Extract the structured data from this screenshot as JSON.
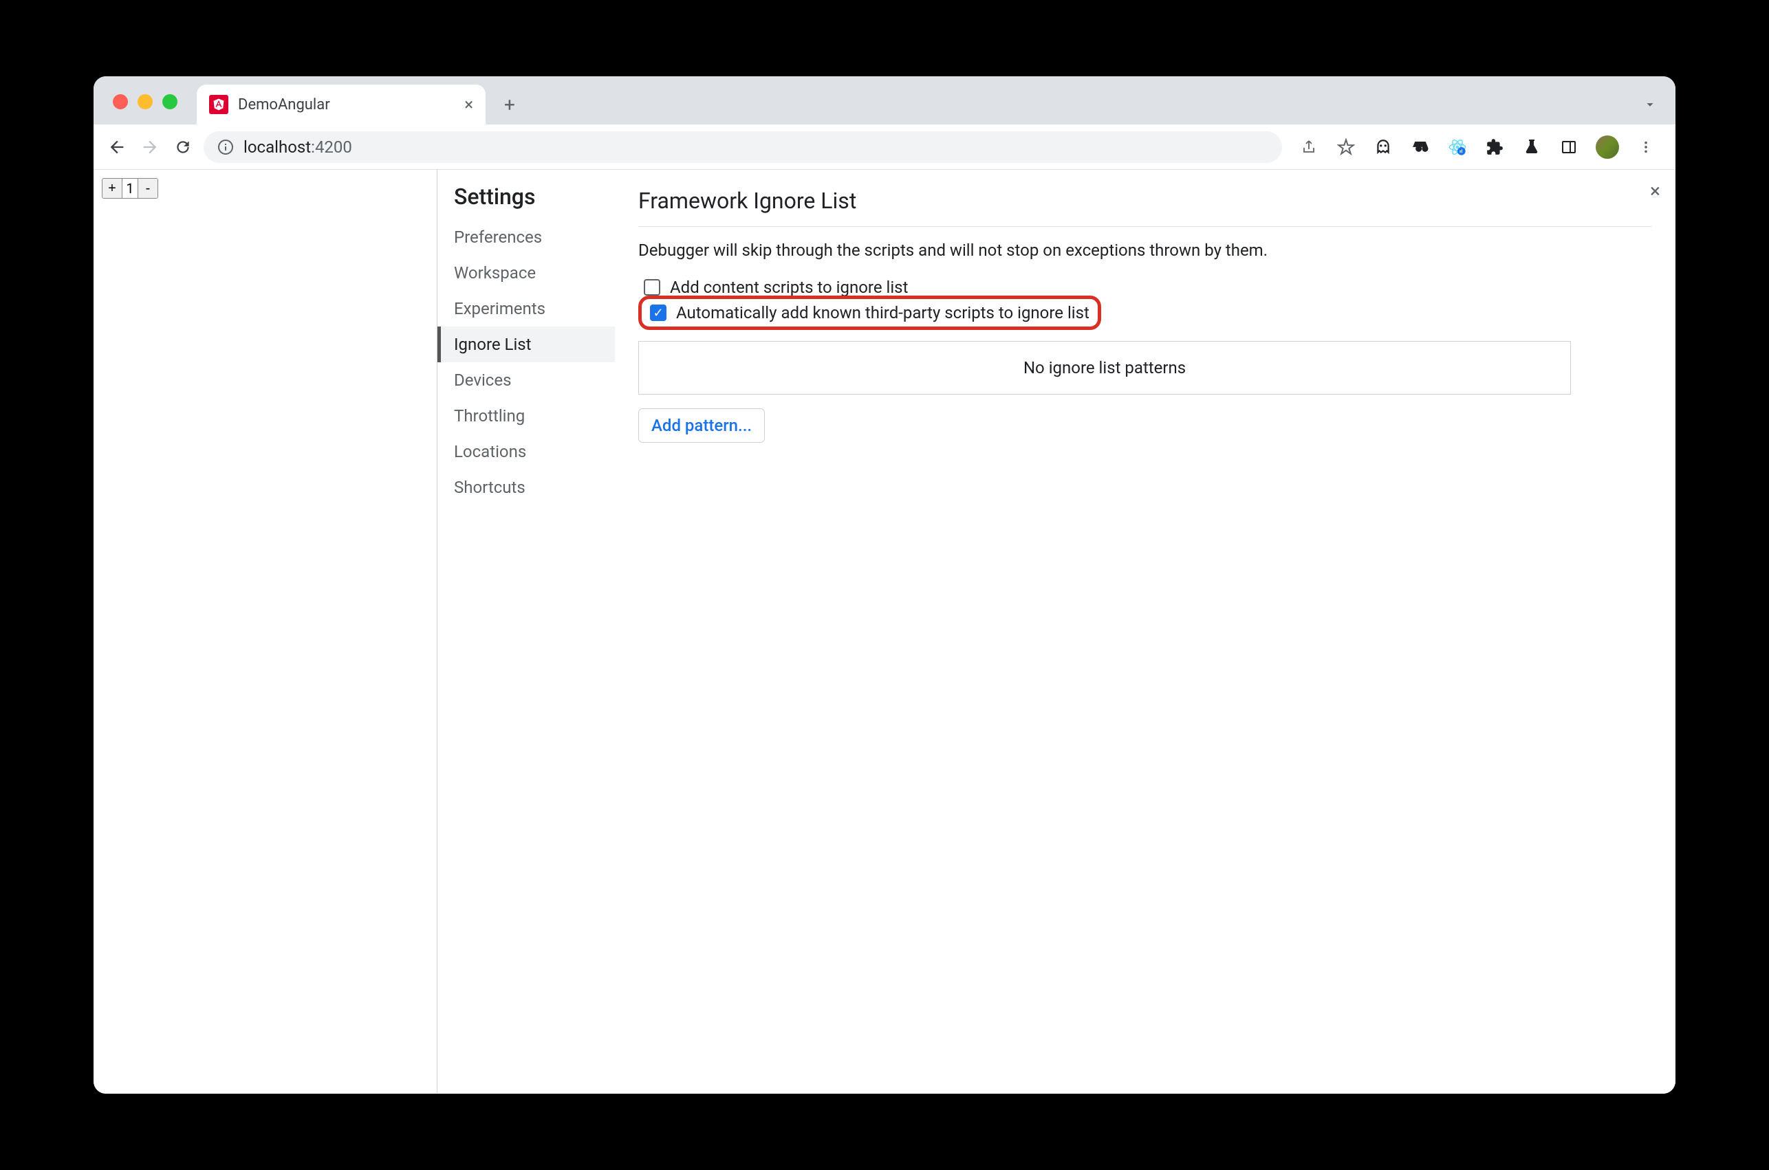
{
  "tab": {
    "title": "DemoAngular"
  },
  "url": {
    "host": "localhost",
    "port": ":4200"
  },
  "counter": {
    "plus": "+",
    "value": "1",
    "minus": "-"
  },
  "settings": {
    "title": "Settings",
    "nav": [
      "Preferences",
      "Workspace",
      "Experiments",
      "Ignore List",
      "Devices",
      "Throttling",
      "Locations",
      "Shortcuts"
    ],
    "active_index": 3
  },
  "panel": {
    "title": "Framework Ignore List",
    "desc": "Debugger will skip through the scripts and will not stop on exceptions thrown by them.",
    "checkbox1": {
      "label": "Add content scripts to ignore list",
      "checked": false
    },
    "checkbox2": {
      "label": "Automatically add known third-party scripts to ignore list",
      "checked": true
    },
    "no_patterns": "No ignore list patterns",
    "add_pattern": "Add pattern..."
  }
}
